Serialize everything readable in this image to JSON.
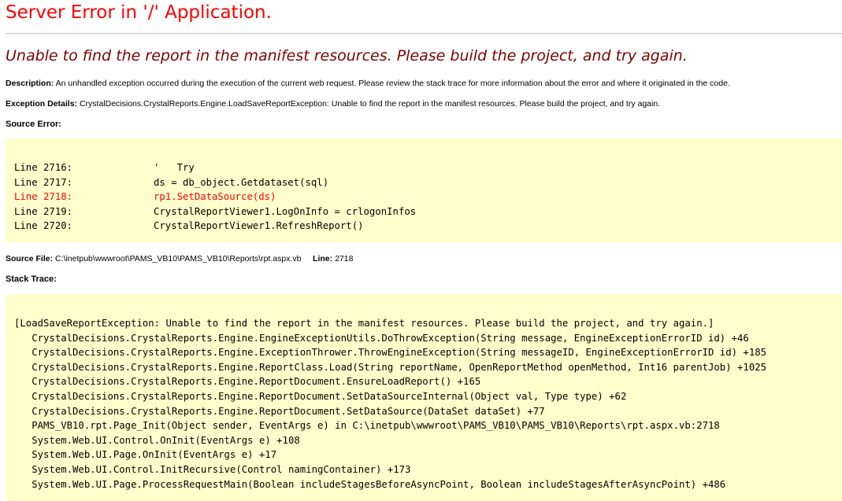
{
  "page": {
    "title": "Server Error in '/' Application.",
    "message": "Unable to find the report in the manifest resources. Please build the project, and try again."
  },
  "description": {
    "label": "Description:",
    "text": "An unhandled exception occurred during the execution of the current web request. Please review the stack trace for more information about the error and where it originated in the code."
  },
  "exception": {
    "label": "Exception Details:",
    "text": "CrystalDecisions.CrystalReports.Engine.LoadSaveReportException: Unable to find the report in the manifest resources. Please build the project, and try again."
  },
  "source_error": {
    "label": "Source Error:",
    "lines": [
      {
        "num": "Line 2716:",
        "code": "'   Try",
        "highlight": false
      },
      {
        "num": "Line 2717:",
        "code": "ds = db_object.Getdataset(sql)",
        "highlight": false
      },
      {
        "num": "Line 2718:",
        "code": "rp1.SetDataSource(ds)",
        "highlight": true
      },
      {
        "num": "Line 2719:",
        "code": "CrystalReportViewer1.LogOnInfo = crlogonInfos",
        "highlight": false
      },
      {
        "num": "Line 2720:",
        "code": "CrystalReportViewer1.RefreshReport()",
        "highlight": false
      }
    ]
  },
  "source_file": {
    "label": "Source File:",
    "path": "C:\\inetpub\\wwwroot\\PAMS_VB10\\PAMS_VB10\\Reports\\rpt.aspx.vb",
    "line_label": "Line:",
    "line_value": "2718"
  },
  "stack_trace": {
    "label": "Stack Trace:",
    "lines": [
      "[LoadSaveReportException: Unable to find the report in the manifest resources. Please build the project, and try again.]",
      "   CrystalDecisions.CrystalReports.Engine.EngineExceptionUtils.DoThrowException(String message, EngineExceptionErrorID id) +46",
      "   CrystalDecisions.CrystalReports.Engine.ExceptionThrower.ThrowEngineException(String messageID, EngineExceptionErrorID id) +185",
      "   CrystalDecisions.CrystalReports.Engine.ReportClass.Load(String reportName, OpenReportMethod openMethod, Int16 parentJob) +1025",
      "   CrystalDecisions.CrystalReports.Engine.ReportDocument.EnsureLoadReport() +165",
      "   CrystalDecisions.CrystalReports.Engine.ReportDocument.SetDataSourceInternal(Object val, Type type) +62",
      "   CrystalDecisions.CrystalReports.Engine.ReportDocument.SetDataSource(DataSet dataSet) +77",
      "   PAMS_VB10.rpt.Page_Init(Object sender, EventArgs e) in C:\\inetpub\\wwwroot\\PAMS_VB10\\PAMS_VB10\\Reports\\rpt.aspx.vb:2718",
      "   System.Web.UI.Control.OnInit(EventArgs e) +108",
      "   System.Web.UI.Page.OnInit(EventArgs e) +17",
      "   System.Web.UI.Control.InitRecursive(Control namingContainer) +173",
      "   System.Web.UI.Page.ProcessRequestMain(Boolean includeStagesBeforeAsyncPoint, Boolean includeStagesAfterAsyncPoint) +486"
    ]
  },
  "colors": {
    "title": "#ff0000",
    "message": "#800000",
    "code_background": "#ffffcc",
    "highlight_line": "#ff0000",
    "rule": "#c0c0c0"
  }
}
